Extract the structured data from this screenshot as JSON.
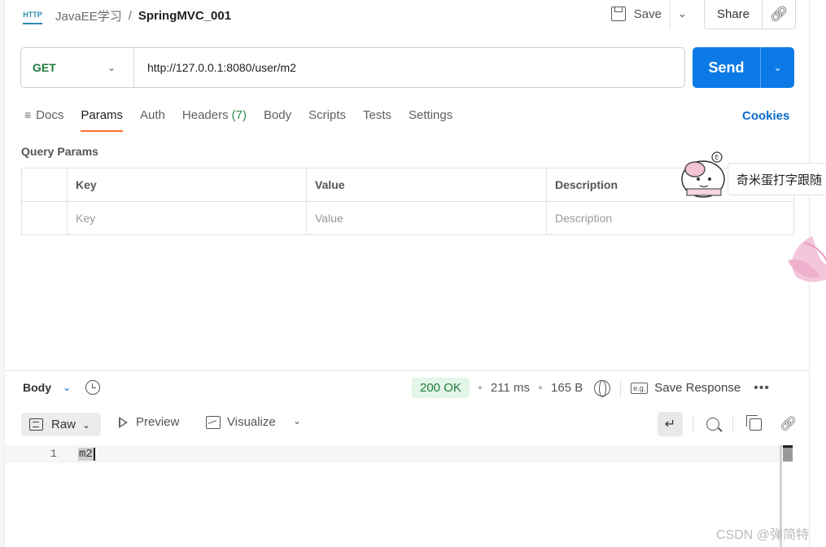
{
  "header": {
    "http_icon_text": "HTTP",
    "breadcrumb_parent": "JavaEE学习",
    "breadcrumb_separator": "/",
    "breadcrumb_current": "SpringMVC_001",
    "save_label": "Save",
    "share_label": "Share"
  },
  "request": {
    "method": "GET",
    "url": "http://127.0.0.1:8080/user/m2",
    "send_label": "Send"
  },
  "tabs": [
    {
      "label": "Docs",
      "count": ""
    },
    {
      "label": "Params",
      "count": ""
    },
    {
      "label": "Auth",
      "count": ""
    },
    {
      "label": "Headers",
      "count": "(7)"
    },
    {
      "label": "Body",
      "count": ""
    },
    {
      "label": "Scripts",
      "count": ""
    },
    {
      "label": "Tests",
      "count": ""
    },
    {
      "label": "Settings",
      "count": ""
    }
  ],
  "active_tab": "Params",
  "cookies_label": "Cookies",
  "query_params": {
    "title": "Query Params",
    "headers": [
      "Key",
      "Value",
      "Description"
    ],
    "placeholder_row": [
      "Key",
      "Value",
      "Description"
    ]
  },
  "overlay": {
    "sticker_badge": "E",
    "banner_text": "奇米蛋打字跟随"
  },
  "response": {
    "body_label": "Body",
    "status": "200 OK",
    "time": "211 ms",
    "size": "165 B",
    "example_icon_text": "e.g.",
    "save_response_label": "Save Response",
    "format_label": "Raw",
    "preview_label": "Preview",
    "visualize_label": "Visualize",
    "lines": [
      {
        "number": "1",
        "text": "m2"
      }
    ]
  },
  "colors": {
    "send_button": "#0b7ae6",
    "method_get": "#1f7a3f",
    "status_ok_bg": "#e3f6e8",
    "active_tab_underline": "#ff6c37",
    "cookies_link": "#0b6bcb"
  },
  "icons": [
    "http-icon",
    "save-icon",
    "chevron-down-icon",
    "link-icon",
    "docs-icon",
    "history-icon",
    "globe-icon",
    "example-icon",
    "more-icon",
    "raw-icon",
    "play-icon",
    "image-icon",
    "wrap-icon",
    "search-icon",
    "copy-icon"
  ],
  "watermark": "CSDN @弹简特"
}
